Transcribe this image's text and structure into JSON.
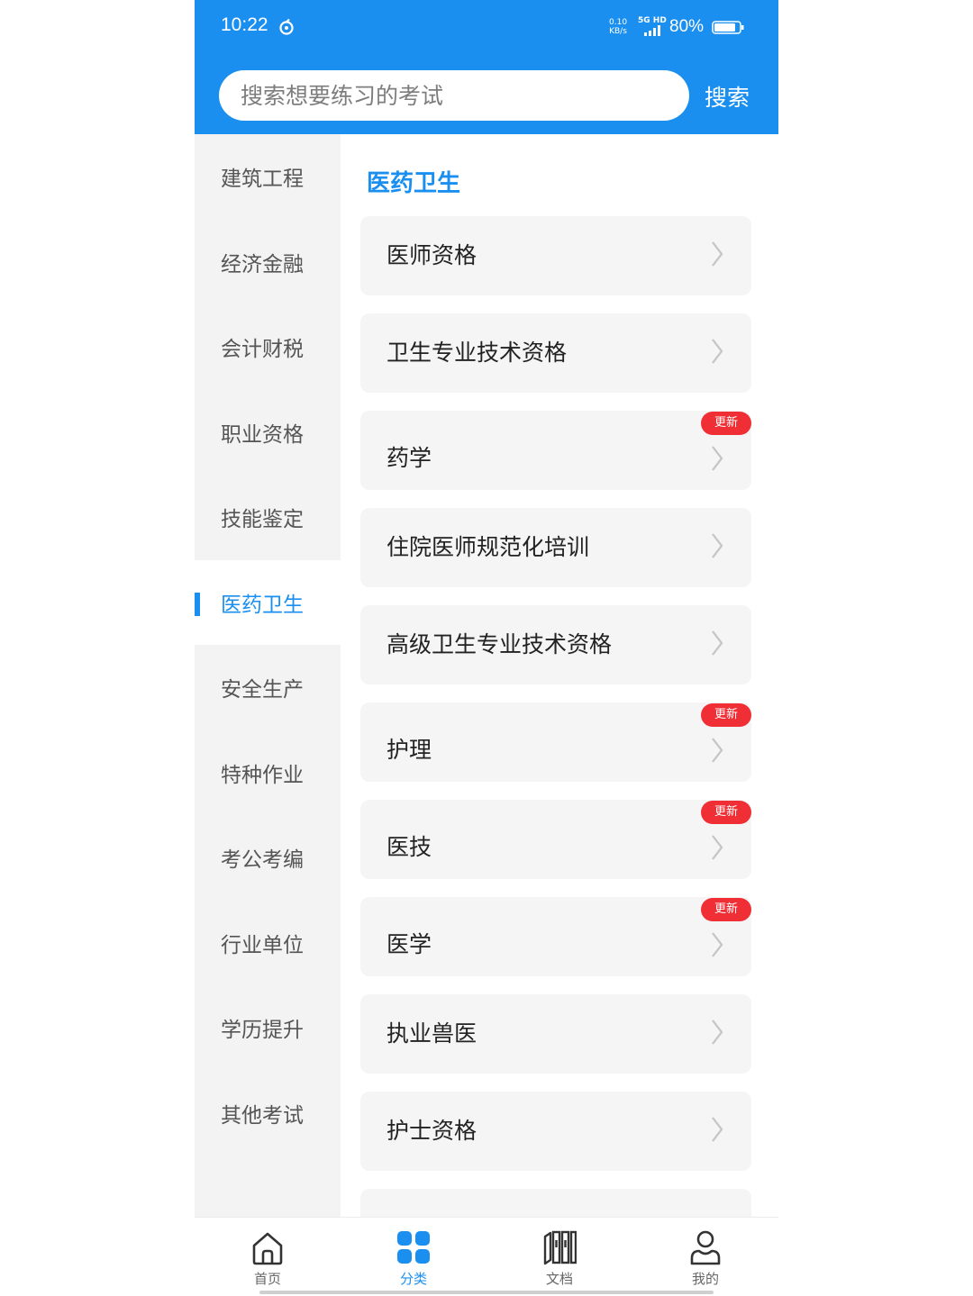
{
  "status_bar": {
    "time": "10:22",
    "net_speed_value": "0.10",
    "net_speed_unit": "KB/s",
    "network_label": "5G HD",
    "battery": "80%",
    "icons": [
      "sync-icon",
      "signal-icon",
      "battery-icon"
    ]
  },
  "search": {
    "placeholder": "搜索想要练习的考试",
    "button_label": "搜索"
  },
  "sidebar": {
    "items": [
      {
        "label": "建筑工程",
        "active": false
      },
      {
        "label": "经济金融",
        "active": false
      },
      {
        "label": "会计财税",
        "active": false
      },
      {
        "label": "职业资格",
        "active": false
      },
      {
        "label": "技能鉴定",
        "active": false
      },
      {
        "label": "医药卫生",
        "active": true
      },
      {
        "label": "安全生产",
        "active": false
      },
      {
        "label": "特种作业",
        "active": false
      },
      {
        "label": "考公考编",
        "active": false
      },
      {
        "label": "行业单位",
        "active": false
      },
      {
        "label": "学历提升",
        "active": false
      },
      {
        "label": "其他考试",
        "active": false
      }
    ]
  },
  "content": {
    "section_title": "医药卫生",
    "badge_text": "更新",
    "items": [
      {
        "label": "医师资格",
        "updated": false
      },
      {
        "label": "卫生专业技术资格",
        "updated": false
      },
      {
        "label": "药学",
        "updated": true
      },
      {
        "label": "住院医师规范化培训",
        "updated": false
      },
      {
        "label": "高级卫生专业技术资格",
        "updated": false
      },
      {
        "label": "护理",
        "updated": true
      },
      {
        "label": "医技",
        "updated": true
      },
      {
        "label": "医学",
        "updated": true
      },
      {
        "label": "执业兽医",
        "updated": false
      },
      {
        "label": "护士资格",
        "updated": false
      }
    ]
  },
  "bottom_nav": {
    "items": [
      {
        "label": "首页",
        "icon": "home-icon",
        "active": false
      },
      {
        "label": "分类",
        "icon": "category-grid-icon",
        "active": true
      },
      {
        "label": "文档",
        "icon": "document-books-icon",
        "active": false
      },
      {
        "label": "我的",
        "icon": "profile-icon",
        "active": false
      }
    ]
  },
  "colors": {
    "accent": "#1a8ff0",
    "badge": "#ef2f35",
    "sidebar_bg": "#f3f3f3",
    "card_bg": "#f5f5f5"
  }
}
